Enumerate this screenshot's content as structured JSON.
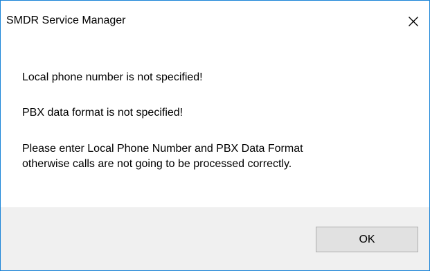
{
  "dialog": {
    "title": "SMDR Service Manager",
    "close_icon": "close-icon",
    "messages": [
      "Local phone number is not specified!",
      "PBX data format is not specified!",
      "Please enter Local Phone Number and PBX Data Format",
      "otherwise calls are not going to be processed correctly."
    ],
    "ok_label": "OK"
  },
  "colors": {
    "border": "#1883d7",
    "footer_bg": "#f0f0f0",
    "button_bg": "#e1e1e1",
    "button_border": "#adadad"
  }
}
